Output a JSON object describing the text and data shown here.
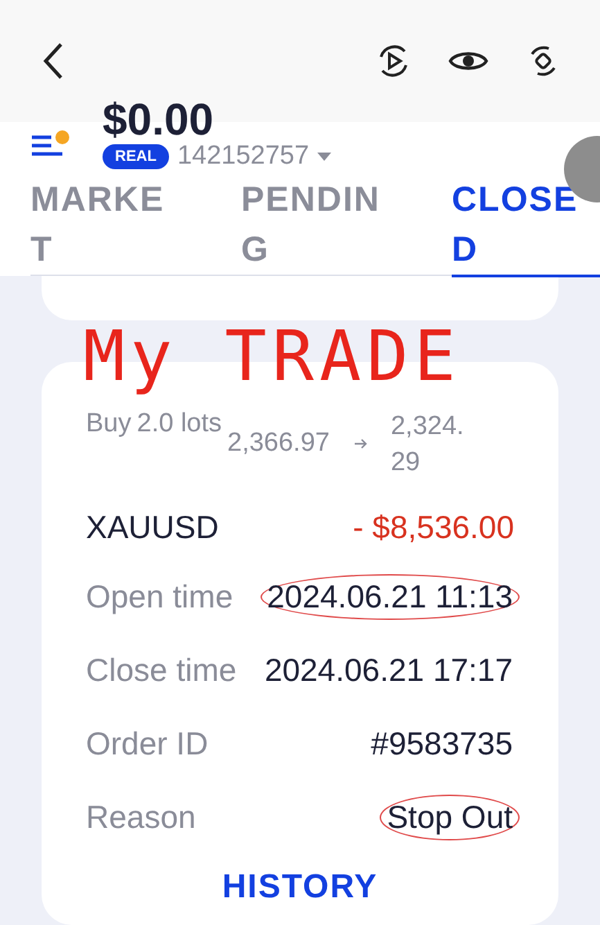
{
  "header": {
    "balance": "$0.00",
    "account_type": "REAL",
    "account_number": "142152757"
  },
  "tabs": [
    {
      "label": "MARKET",
      "selected": false
    },
    {
      "label": "PENDING",
      "selected": false
    },
    {
      "label": "CLOSED",
      "selected": true
    }
  ],
  "annotation": "My TRADE",
  "trade": {
    "side": "Buy",
    "lots": "2.0 lots",
    "open_price": "2,366.97",
    "close_price": "2,324.29",
    "symbol": "XAUUSD",
    "profit": "- $8,536.00",
    "details": [
      {
        "label": "Open time",
        "value": "2024.06.21 11:13",
        "circled": true
      },
      {
        "label": "Close time",
        "value": "2024.06.21 17:17",
        "circled": false
      },
      {
        "label": "Order ID",
        "value": "#9583735",
        "circled": false
      },
      {
        "label": "Reason",
        "value": "Stop Out",
        "circled": true
      }
    ],
    "history_link": "HISTORY"
  }
}
